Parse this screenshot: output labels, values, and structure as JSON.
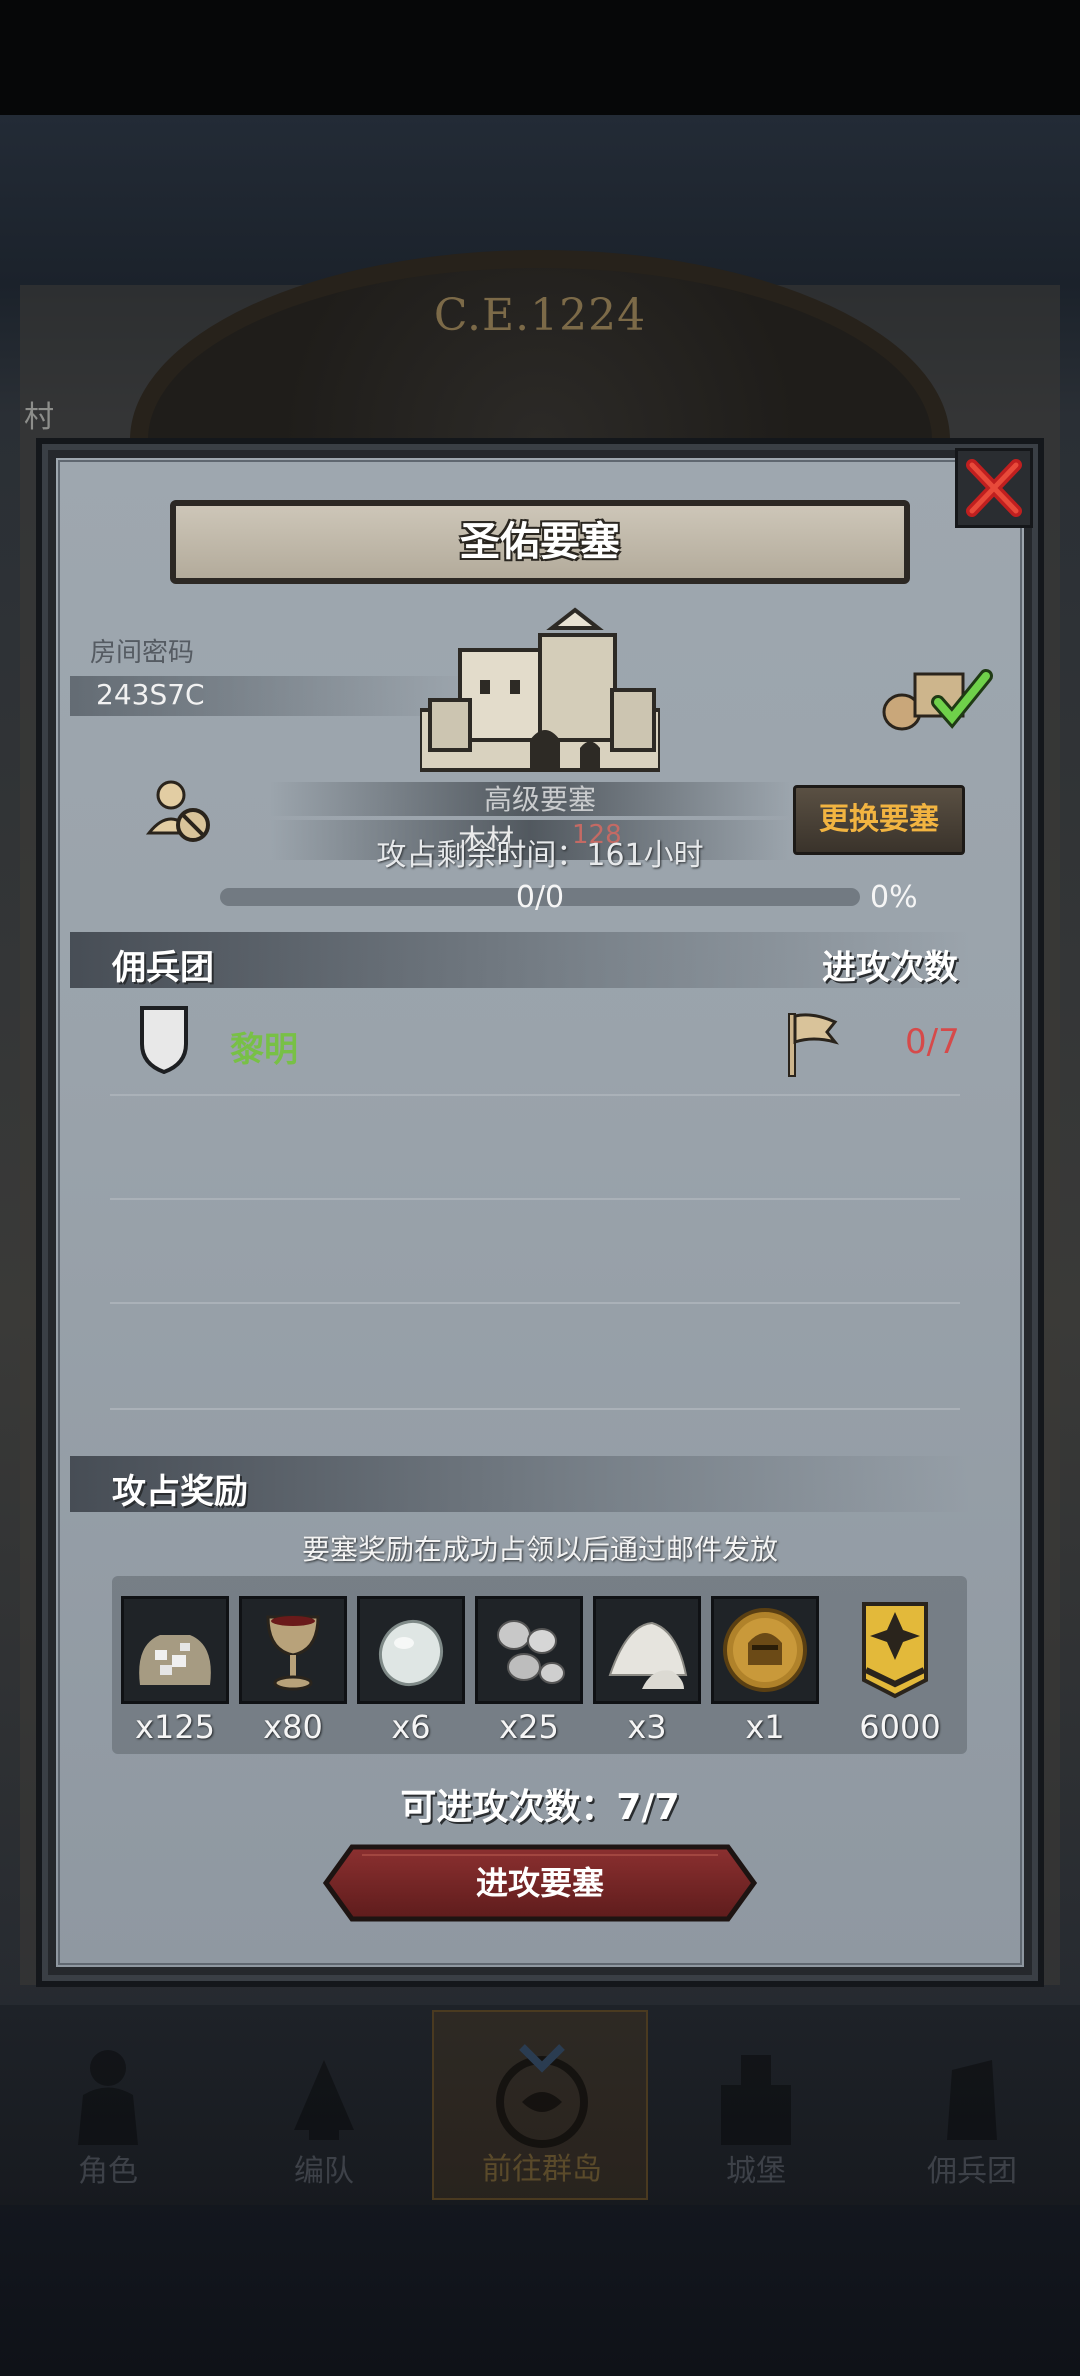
{
  "background": {
    "era": "C.E.1224",
    "village_label": "村"
  },
  "dialog": {
    "title": "圣佑要塞",
    "room_password_label": "房间密码",
    "room_password_value": "243S7C",
    "fortress_type": "高级要塞",
    "wood_label": "木材",
    "wood_value": "128",
    "time_left": "攻占剩余时间：161小时",
    "change_button": "更换要塞",
    "progress": {
      "count": "0/0",
      "percent_text": "0%",
      "fraction": 0
    },
    "mercenary_header": "佣兵团",
    "attacks_header": "进攻次数",
    "mercenaries": [
      {
        "name": "黎明",
        "attacks": "0/7"
      }
    ],
    "reward_header": "攻占奖励",
    "reward_note": "要塞奖励在成功占领以后通过邮件发放",
    "rewards": [
      {
        "icon": "silver-ore-sack-icon",
        "qty": "x125"
      },
      {
        "icon": "goblet-icon",
        "qty": "x80"
      },
      {
        "icon": "moonstone-icon",
        "qty": "x6"
      },
      {
        "icon": "silver-coins-icon",
        "qty": "x25"
      },
      {
        "icon": "white-powder-icon",
        "qty": "x3"
      },
      {
        "icon": "knight-helmet-medal-icon",
        "qty": "x1"
      },
      {
        "icon": "rank-chevron-icon",
        "qty": "6000"
      }
    ],
    "attack_count": "可进攻次数：7/7",
    "attack_button": "进攻要塞"
  },
  "bottom_nav": [
    {
      "label": "角色",
      "icon": "character-icon"
    },
    {
      "label": "编队",
      "icon": "formation-icon"
    },
    {
      "label": "前往群岛",
      "icon": "islands-icon"
    },
    {
      "label": "城堡",
      "icon": "castle-icon"
    },
    {
      "label": "佣兵团",
      "icon": "mercenary-icon"
    }
  ],
  "colors": {
    "accent_gold": "#f2b441",
    "name_green": "#78c046",
    "count_red": "#d64a4a",
    "button_red": "#7a2a2a"
  }
}
